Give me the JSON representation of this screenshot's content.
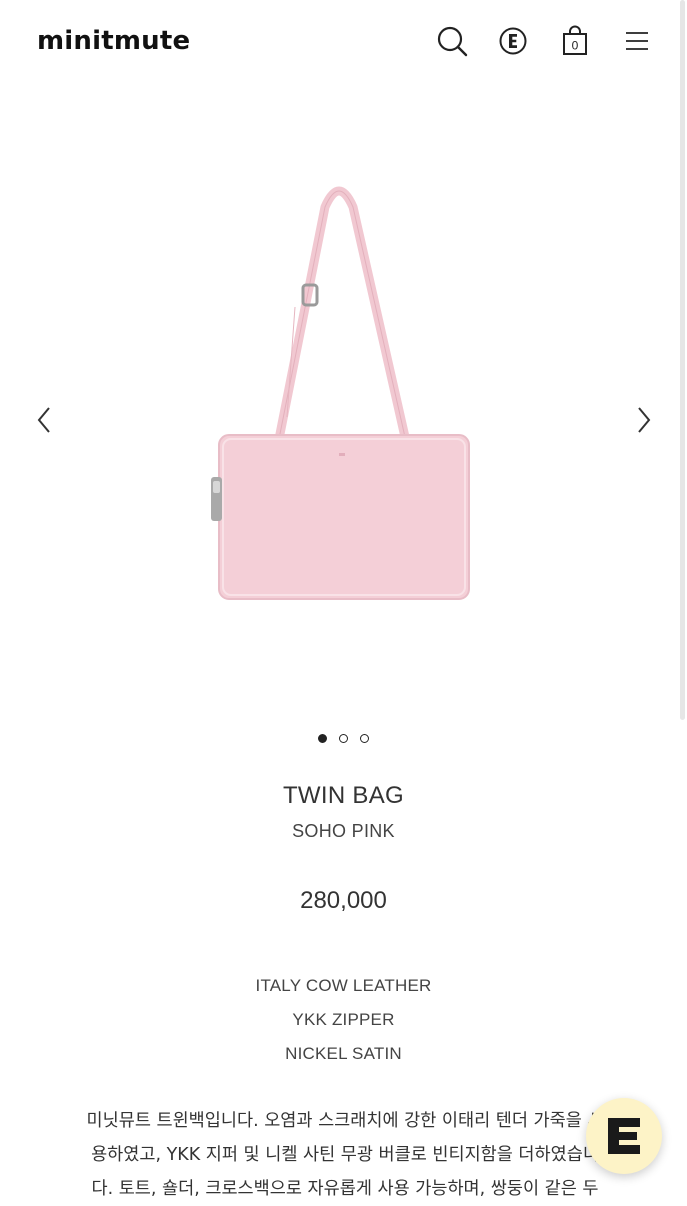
{
  "header": {
    "logo": "minitmute",
    "cart_count": "0",
    "icons": [
      "search-icon",
      "e-logo-icon",
      "shopping-bag-icon",
      "hamburger-menu-icon"
    ]
  },
  "gallery": {
    "image_description": "pink rectangular shoulder bag with strap",
    "bag_color": "#f4cfd7",
    "dots": 3,
    "active_dot": 1
  },
  "product": {
    "name": "TWIN BAG",
    "color": "SOHO PINK",
    "price": "280,000",
    "specs": [
      "ITALY COW LEATHER",
      "YKK ZIPPER",
      "NICKEL SATIN"
    ],
    "description_lines": [
      "미닛뮤트 트윈백입니다. 오염과 스크래치에 강한 이태리 텐더 가죽을 사",
      "용하였고, YKK 지퍼 및 니켈 사틴 무광 버클로 빈티지함을 더하였습니",
      "다. 토트, 숄더, 크로스백으로 자유롭게 사용 가능하며, 쌍둥이 같은 두"
    ]
  },
  "fab": {
    "icon": "e-chat-icon",
    "color": "#fdf3c7"
  }
}
